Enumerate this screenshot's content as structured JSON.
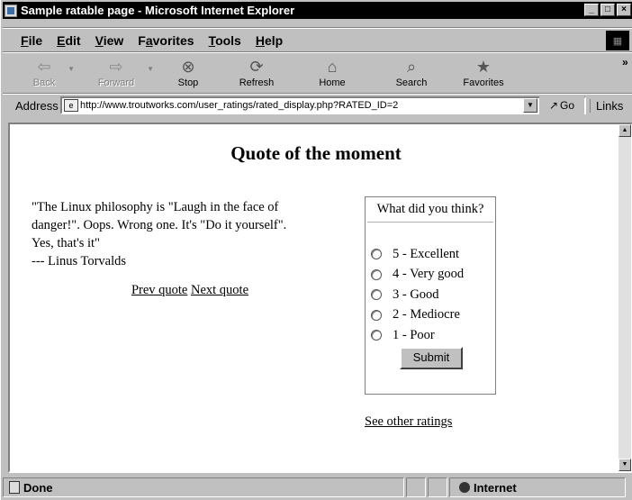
{
  "window": {
    "title": "Sample ratable page - Microsoft Internet Explorer",
    "controls": [
      "_",
      "□",
      "×"
    ]
  },
  "menubar": {
    "items": [
      {
        "label": "File",
        "accel": "F"
      },
      {
        "label": "Edit",
        "accel": "E"
      },
      {
        "label": "View",
        "accel": "V"
      },
      {
        "label": "Favorites",
        "accel": "a"
      },
      {
        "label": "Tools",
        "accel": "T"
      },
      {
        "label": "Help",
        "accel": "H"
      }
    ]
  },
  "toolbar": {
    "back": "Back",
    "forward": "Forward",
    "stop": "Stop",
    "refresh": "Refresh",
    "home": "Home",
    "search": "Search",
    "favorites": "Favorites",
    "more": "»"
  },
  "addressbar": {
    "label": "Address",
    "url": "http://www.troutworks.com/user_ratings/rated_display.php?RATED_ID=2",
    "go": "Go",
    "links": "Links"
  },
  "page": {
    "heading": "Quote of the moment",
    "quote_lines": [
      "\"The Linux philosophy is \"Laugh in the face of",
      "danger!\". Oops. Wrong one. It's \"Do it yourself\".",
      "Yes, that's it\"",
      "--- Linus Torvalds"
    ],
    "prev_quote": "Prev quote",
    "next_quote": "Next quote",
    "rating": {
      "question": "What did you think?",
      "options": [
        "5 - Excellent",
        "4 - Very good",
        "3 - Good",
        "2 - Mediocre",
        "1 - Poor"
      ],
      "submit": "Submit"
    },
    "see_other": "See other ratings"
  },
  "statusbar": {
    "status": "Done",
    "zone": "Internet"
  }
}
